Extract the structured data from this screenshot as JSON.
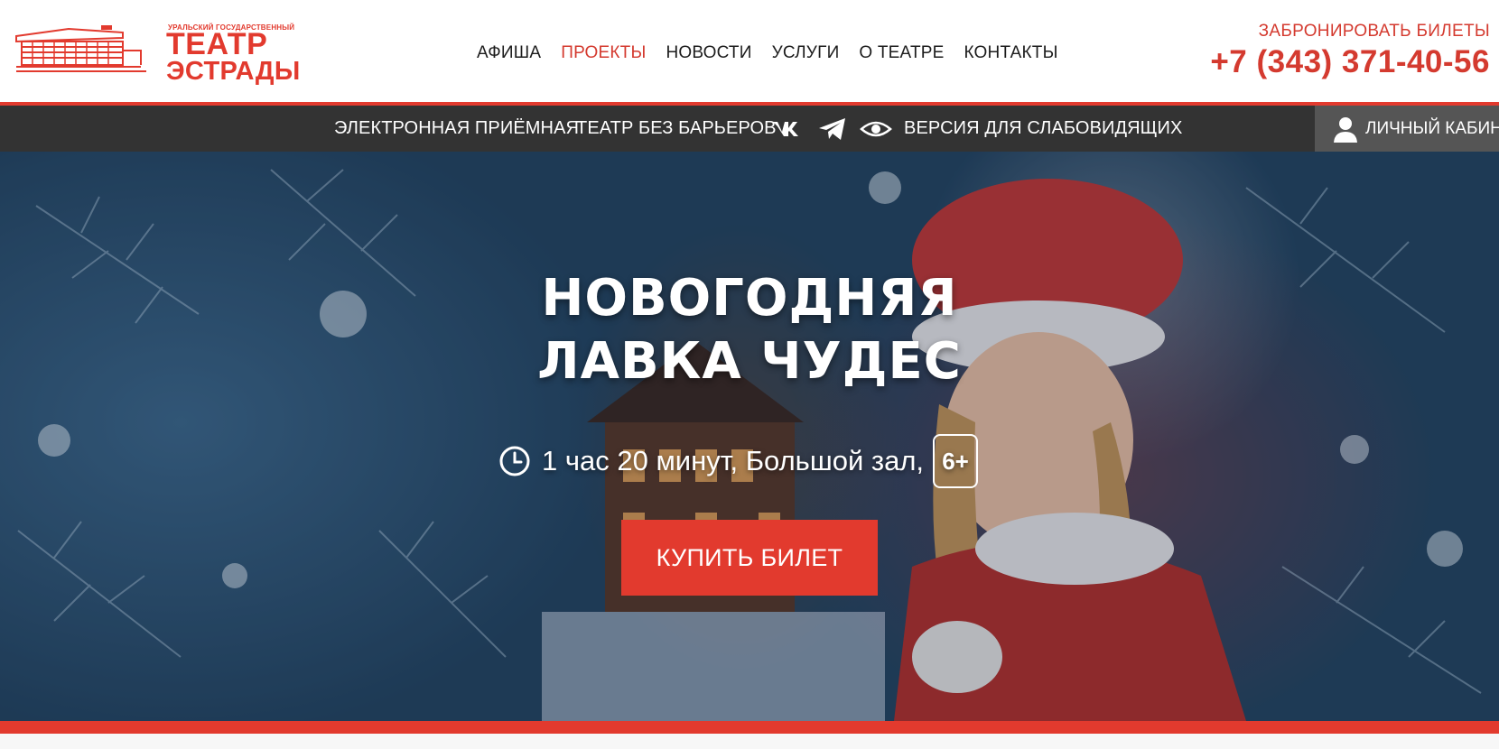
{
  "logo": {
    "subtitle": "УРАЛЬСКИЙ ГОСУДАРСТВЕННЫЙ",
    "title_line1": "ТЕАТР",
    "title_line2": "ЭСТРАДЫ"
  },
  "nav": {
    "items": [
      {
        "label": "АФИША",
        "active": false
      },
      {
        "label": "ПРОЕКТЫ",
        "active": true
      },
      {
        "label": "НОВОСТИ",
        "active": false
      },
      {
        "label": "УСЛУГИ",
        "active": false
      },
      {
        "label": "О ТЕАТРЕ",
        "active": false
      },
      {
        "label": "КОНТАКТЫ",
        "active": false
      }
    ]
  },
  "booking": {
    "label": "ЗАБРОНИРОВАТЬ БИЛЕТЫ",
    "phone": "+7 (343) 371-40-56"
  },
  "subbar": {
    "reception": "ЭЛЕКТРОННАЯ ПРИЁМНАЯ",
    "barrier_free": "ТЕАТР БЕЗ БАРЬЕРОВ",
    "vk_icon": "vk-icon",
    "telegram_icon": "telegram-icon",
    "eye_icon": "eye-icon",
    "low_vision": "ВЕРСИЯ ДЛЯ СЛАБОВИДЯЩИХ",
    "cabinet": "ЛИЧНЫЙ КАБИНЕТ"
  },
  "hero": {
    "title_line1": "НОВОГОДНЯЯ",
    "title_line2": "ЛАВКА ЧУДЕС",
    "details": "1 час 20 минут, Большой зал,",
    "age": "6+",
    "buy_label": "КУПИТЬ БИЛЕТ"
  },
  "colors": {
    "accent": "#e23a2e",
    "dark_bar": "#333333",
    "cabinet_bg": "#555555",
    "text_dark": "#1c1c1c"
  }
}
